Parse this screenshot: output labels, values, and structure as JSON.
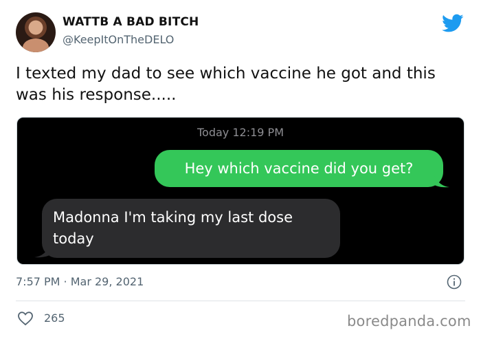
{
  "author": {
    "display_name": "WATTB A BAD BITCH",
    "handle": "@KeepItOnTheDELO"
  },
  "tweet": {
    "text": "I texted my dad to see which vaccine he got and this was his response.....",
    "timestamp": "7:57 PM · Mar 29, 2021",
    "likes": "265"
  },
  "imessage": {
    "time_label": "Today 12:19 PM",
    "sent": "Hey which vaccine did you get?",
    "received": "Madonna I'm taking my last dose today"
  },
  "watermark": "boredpanda.com",
  "icons": {
    "brand": "twitter-bird-icon",
    "info": "info-icon",
    "like": "heart-icon"
  },
  "colors": {
    "twitter_blue": "#1d9bf0",
    "sent_bubble": "#34c759",
    "received_bubble": "#2c2c2e",
    "secondary_text": "#536471"
  }
}
